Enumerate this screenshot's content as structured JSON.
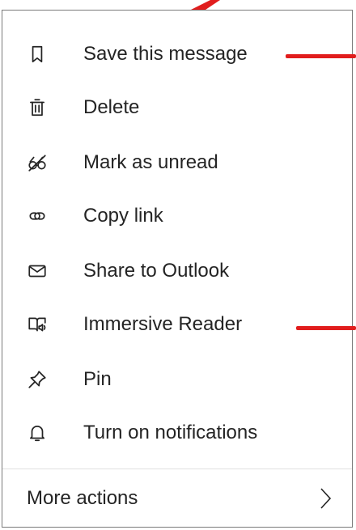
{
  "menu": {
    "items": [
      {
        "label": "Save this message",
        "icon": "bookmark-icon"
      },
      {
        "label": "Delete",
        "icon": "trash-icon"
      },
      {
        "label": "Mark as unread",
        "icon": "glasses-unread-icon"
      },
      {
        "label": "Copy link",
        "icon": "link-icon"
      },
      {
        "label": "Share to Outlook",
        "icon": "mail-icon"
      },
      {
        "label": "Immersive Reader",
        "icon": "immersive-reader-icon"
      },
      {
        "label": "Pin",
        "icon": "pin-icon"
      },
      {
        "label": "Turn on notifications",
        "icon": "bell-icon"
      }
    ],
    "more_actions": {
      "label": "More actions",
      "icon": "chevron-right-icon"
    }
  },
  "colors": {
    "annotation": "#e11d1d",
    "text": "#242424",
    "border": "#7a7a7a"
  }
}
